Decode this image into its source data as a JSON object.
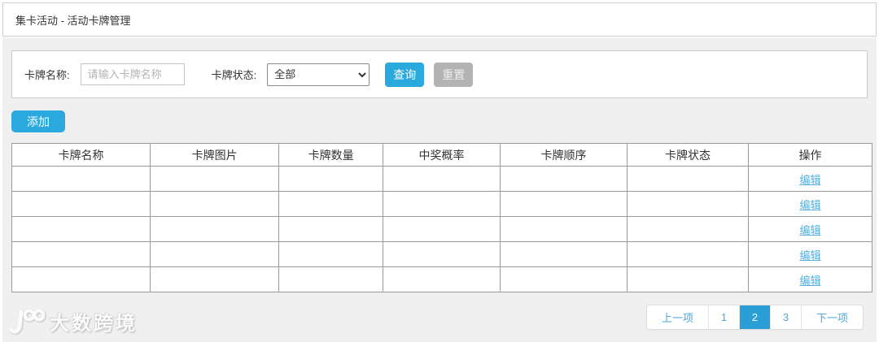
{
  "breadcrumb": "集卡活动 - 活动卡牌管理",
  "filters": {
    "name_label": "卡牌名称:",
    "name_placeholder": "请输入卡牌名称",
    "name_value": "",
    "status_label": "卡牌状态:",
    "status_value": "全部",
    "search_label": "查询",
    "reset_label": "重置"
  },
  "toolbar": {
    "add_label": "添加"
  },
  "table": {
    "headers": [
      "卡牌名称",
      "卡牌图片",
      "卡牌数量",
      "中奖概率",
      "卡牌顺序",
      "卡牌状态",
      "操作"
    ],
    "rows": [
      {
        "name": "",
        "image": "",
        "quantity": "",
        "probability": "",
        "order": "",
        "status": "",
        "action": "编辑"
      },
      {
        "name": "",
        "image": "",
        "quantity": "",
        "probability": "",
        "order": "",
        "status": "",
        "action": "编辑"
      },
      {
        "name": "",
        "image": "",
        "quantity": "",
        "probability": "",
        "order": "",
        "status": "",
        "action": "编辑"
      },
      {
        "name": "",
        "image": "",
        "quantity": "",
        "probability": "",
        "order": "",
        "status": "",
        "action": "编辑"
      },
      {
        "name": "",
        "image": "",
        "quantity": "",
        "probability": "",
        "order": "",
        "status": "",
        "action": "编辑"
      }
    ]
  },
  "pagination": {
    "prev_label": "上一项",
    "pages": [
      "1",
      "2",
      "3"
    ],
    "active_page": "2",
    "next_label": "下一项"
  },
  "watermark": {
    "text": "大数跨境"
  },
  "colors": {
    "primary_blue": "#29a9dd",
    "active_page_blue": "#299fd6",
    "link_blue": "#55aede",
    "pagination_text_blue": "#4aa9d8",
    "reset_gray": "#b3b3b3",
    "page_background": "#f0f0f0",
    "table_border": "#9a9a9a"
  }
}
